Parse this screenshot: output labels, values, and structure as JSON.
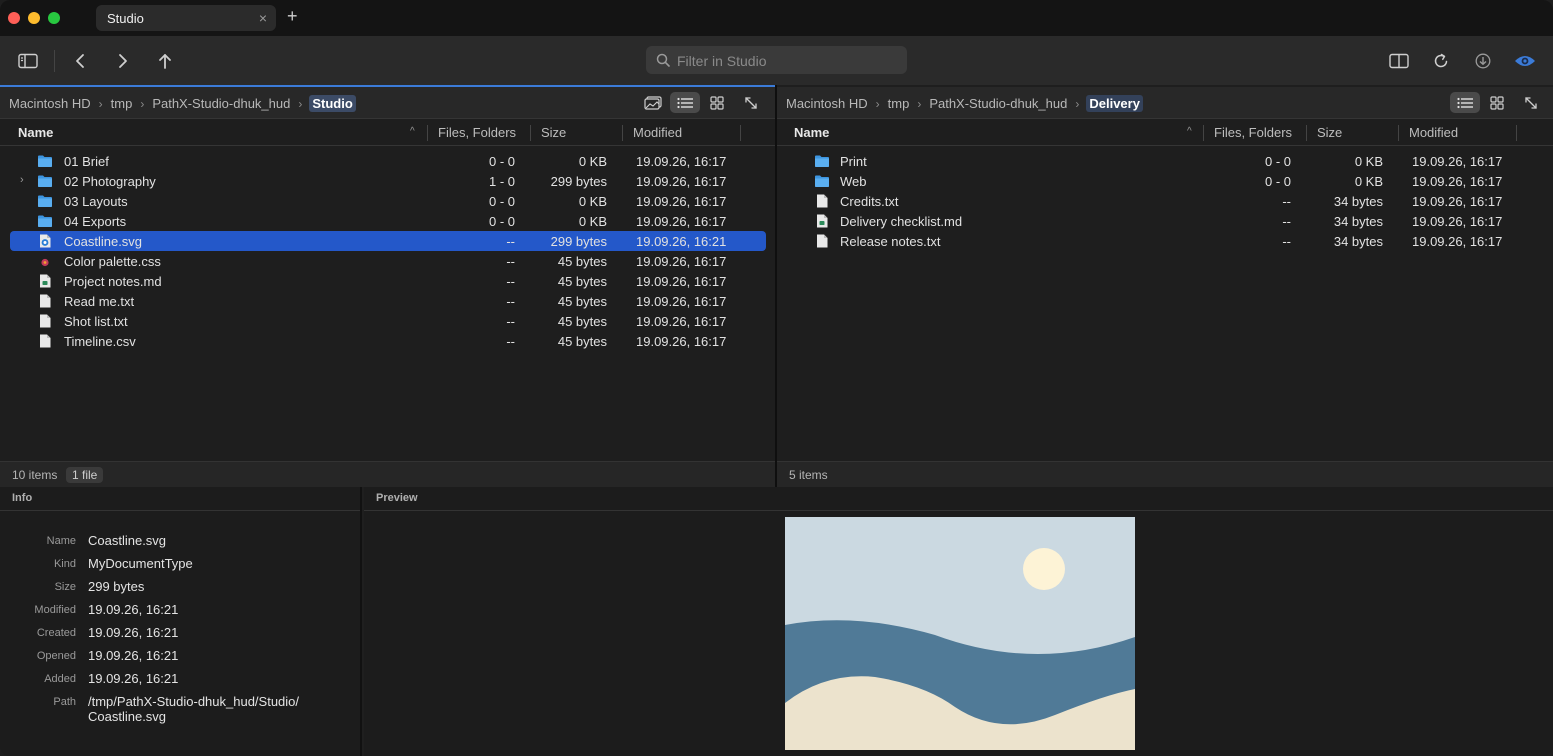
{
  "tab": {
    "title": "Studio",
    "close": "×",
    "add": "+"
  },
  "toolbar": {
    "filter_placeholder": "Filter in Studio",
    "accent": "#3b7bd8"
  },
  "left_pane": {
    "breadcrumbs": [
      "Macintosh HD",
      "tmp",
      "PathX-Studio-dhuk_hud",
      "Studio"
    ],
    "columns": {
      "name": "Name",
      "files_folders": "Files, Folders",
      "size": "Size",
      "modified": "Modified"
    },
    "rows": [
      {
        "name": "01 Brief",
        "kind": "folder",
        "ff": "0 - 0",
        "size": "0 KB",
        "modified": "19.09.26, 16:17",
        "expandable": false,
        "selected": false
      },
      {
        "name": "02 Photography",
        "kind": "folder",
        "ff": "1 - 0",
        "size": "299 bytes",
        "modified": "19.09.26, 16:17",
        "expandable": true,
        "selected": false
      },
      {
        "name": "03 Layouts",
        "kind": "folder",
        "ff": "0 - 0",
        "size": "0 KB",
        "modified": "19.09.26, 16:17",
        "expandable": false,
        "selected": false
      },
      {
        "name": "04 Exports",
        "kind": "folder",
        "ff": "0 - 0",
        "size": "0 KB",
        "modified": "19.09.26, 16:17",
        "expandable": false,
        "selected": false
      },
      {
        "name": "Coastline.svg",
        "kind": "svg",
        "ff": "--",
        "size": "299 bytes",
        "modified": "19.09.26, 16:21",
        "expandable": false,
        "selected": true
      },
      {
        "name": "Color palette.css",
        "kind": "css",
        "ff": "--",
        "size": "45 bytes",
        "modified": "19.09.26, 16:17",
        "expandable": false,
        "selected": false
      },
      {
        "name": "Project notes.md",
        "kind": "md",
        "ff": "--",
        "size": "45 bytes",
        "modified": "19.09.26, 16:17",
        "expandable": false,
        "selected": false
      },
      {
        "name": "Read me.txt",
        "kind": "txt",
        "ff": "--",
        "size": "45 bytes",
        "modified": "19.09.26, 16:17",
        "expandable": false,
        "selected": false
      },
      {
        "name": "Shot list.txt",
        "kind": "txt",
        "ff": "--",
        "size": "45 bytes",
        "modified": "19.09.26, 16:17",
        "expandable": false,
        "selected": false
      },
      {
        "name": "Timeline.csv",
        "kind": "txt",
        "ff": "--",
        "size": "45 bytes",
        "modified": "19.09.26, 16:17",
        "expandable": false,
        "selected": false
      }
    ],
    "status": "10 items",
    "status_badge": "1 file"
  },
  "right_pane": {
    "breadcrumbs": [
      "Macintosh HD",
      "tmp",
      "PathX-Studio-dhuk_hud",
      "Delivery"
    ],
    "columns": {
      "name": "Name",
      "files_folders": "Files, Folders",
      "size": "Size",
      "modified": "Modified"
    },
    "rows": [
      {
        "name": "Print",
        "kind": "folder",
        "ff": "0 - 0",
        "size": "0 KB",
        "modified": "19.09.26, 16:17",
        "expandable": false,
        "selected": false
      },
      {
        "name": "Web",
        "kind": "folder",
        "ff": "0 - 0",
        "size": "0 KB",
        "modified": "19.09.26, 16:17",
        "expandable": false,
        "selected": false
      },
      {
        "name": "Credits.txt",
        "kind": "txt",
        "ff": "--",
        "size": "34 bytes",
        "modified": "19.09.26, 16:17",
        "expandable": false,
        "selected": false
      },
      {
        "name": "Delivery checklist.md",
        "kind": "md",
        "ff": "--",
        "size": "34 bytes",
        "modified": "19.09.26, 16:17",
        "expandable": false,
        "selected": false
      },
      {
        "name": "Release notes.txt",
        "kind": "txt",
        "ff": "--",
        "size": "34 bytes",
        "modified": "19.09.26, 16:17",
        "expandable": false,
        "selected": false
      }
    ],
    "status": "5 items"
  },
  "info": {
    "title": "Info",
    "fields": [
      {
        "key": "Name",
        "value": "Coastline.svg"
      },
      {
        "key": "Kind",
        "value": "MyDocumentType"
      },
      {
        "key": "Size",
        "value": "299 bytes"
      },
      {
        "key": "Modified",
        "value": "19.09.26, 16:21"
      },
      {
        "key": "Created",
        "value": "19.09.26, 16:21"
      },
      {
        "key": "Opened",
        "value": "19.09.26, 16:21"
      },
      {
        "key": "Added",
        "value": "19.09.26, 16:21"
      },
      {
        "key": "Path",
        "value": "/tmp/PathX-Studio-dhuk_hud/Studio/",
        "value2": "Coastline.svg"
      }
    ]
  },
  "preview": {
    "title": "Preview",
    "colors": {
      "sky": "#cbd9e1",
      "sun": "#fdf3d6",
      "water": "#507a97",
      "sand": "#ece3cd"
    }
  },
  "icons": {
    "sidebar": "sidebar-toggle-icon",
    "back": "chevron-left-icon",
    "forward": "chevron-right-icon",
    "up": "arrow-up-icon",
    "split": "split-view-icon",
    "refresh": "refresh-icon",
    "download": "download-icon",
    "preview": "eye-icon"
  }
}
